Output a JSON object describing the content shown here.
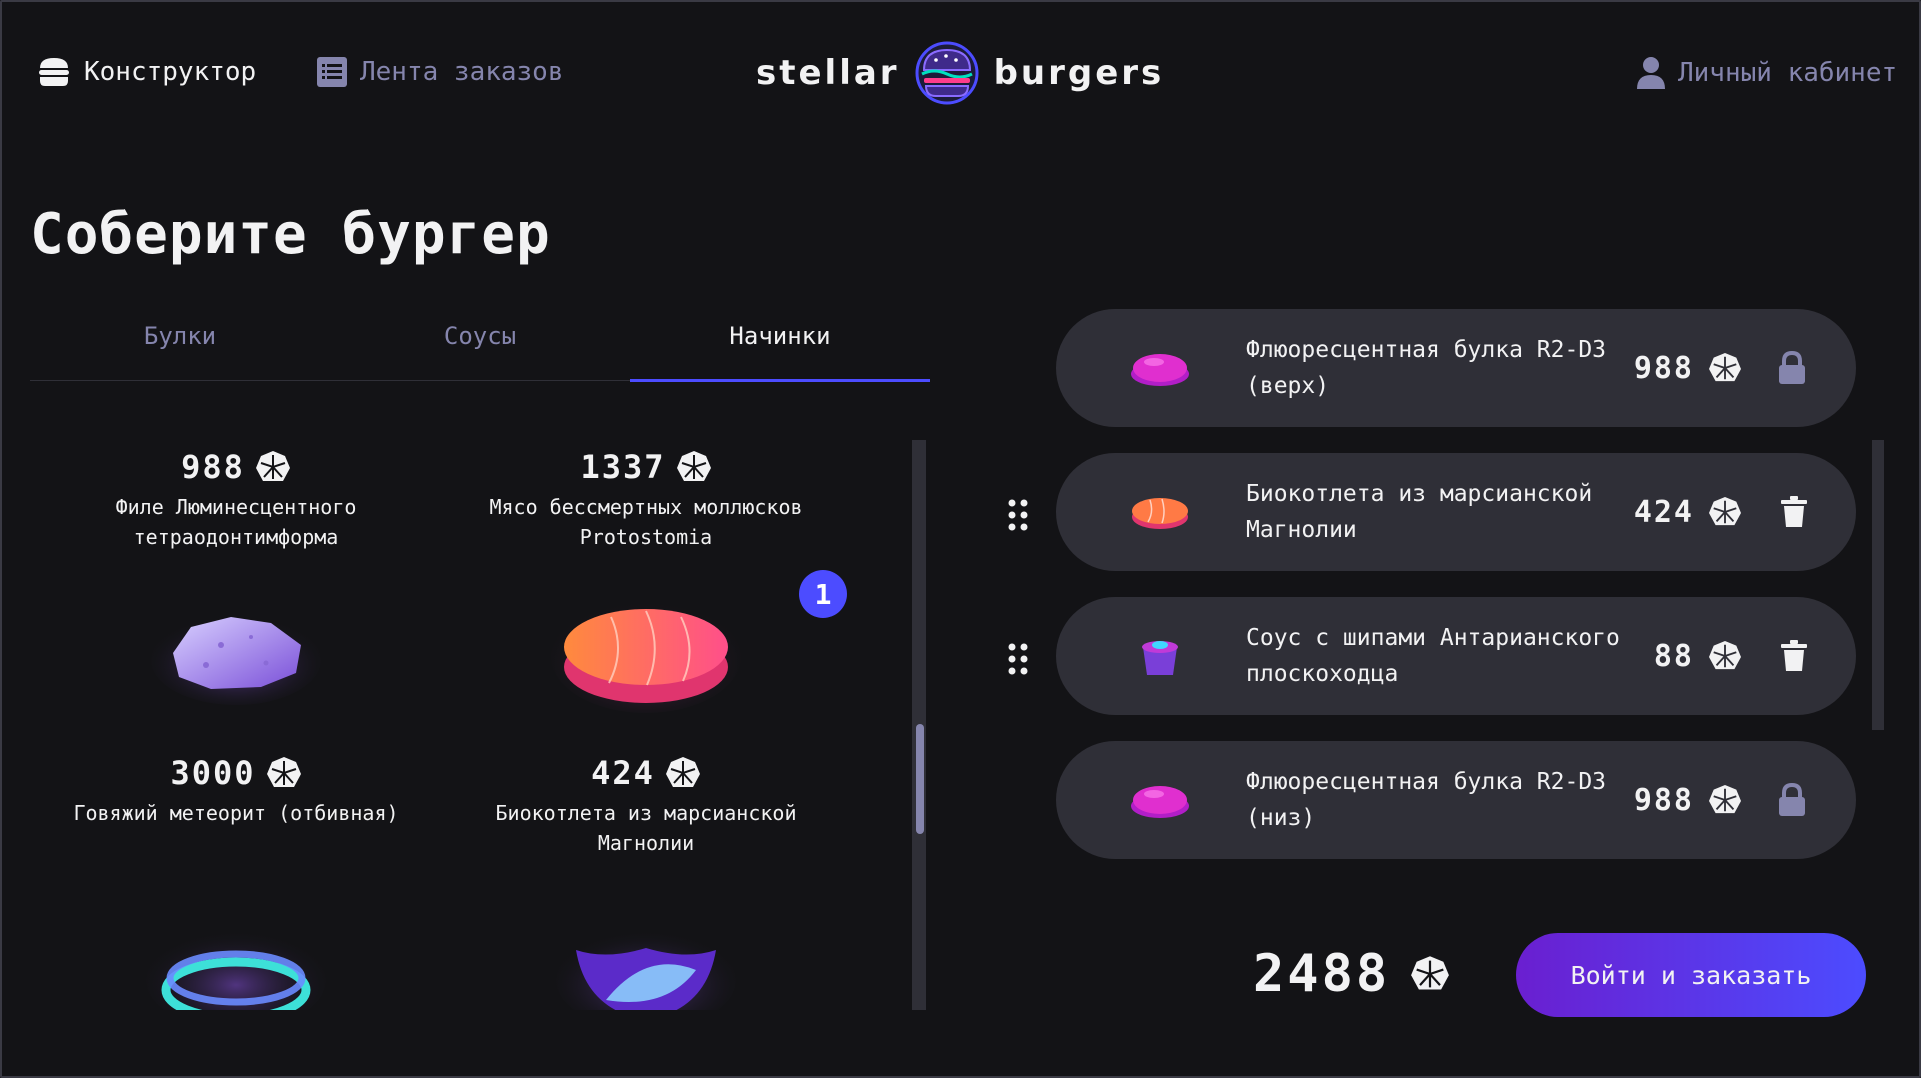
{
  "header": {
    "nav_constructor": "Конструктор",
    "nav_feed": "Лента заказов",
    "logo_left": "stellar",
    "logo_right": "burgers",
    "nav_profile": "Личный кабинет"
  },
  "page_title": "Соберите бургер",
  "tabs": [
    {
      "label": "Булки",
      "active": false
    },
    {
      "label": "Соусы",
      "active": false
    },
    {
      "label": "Начинки",
      "active": true
    }
  ],
  "ingredients": [
    {
      "price": "988",
      "name": "Филе Люминесцентного тетраодонтимформа",
      "icon": "luminescent-fillet-image"
    },
    {
      "price": "1337",
      "name": "Мясо бессмертных моллюсков Protostomia",
      "icon": "mollusk-meat-image"
    },
    {
      "price": "3000",
      "name": "Говяжий метеорит (отбивная)",
      "icon": "meteorite-image"
    },
    {
      "price": "424",
      "name": "Биокотлета из марсианской Магнолии",
      "icon": "bio-patty-image",
      "counter": "1"
    },
    {
      "icon": "rings-image"
    },
    {
      "icon": "leaf-bowl-image"
    }
  ],
  "constructor": {
    "items": [
      {
        "name": "Флюоресцентная булка R2-D3 (верх)",
        "price": "988",
        "action": "lock-icon",
        "locked": true
      },
      {
        "name": "Биокотлета из марсианской Магнолии",
        "price": "424",
        "action": "trash-icon",
        "locked": false
      },
      {
        "name": "Соус с шипами Антарианского плоскоходца",
        "price": "88",
        "action": "trash-icon",
        "locked": false
      },
      {
        "name": "Флюоресцентная булка R2-D3 (низ)",
        "price": "988",
        "action": "lock-icon",
        "locked": true
      }
    ],
    "total": "2488",
    "order_button": "Войти и заказать"
  },
  "colors": {
    "background": "#131316",
    "card": "#2f2f37",
    "accent": "#4c4cff",
    "inactive_text": "#8585ad"
  }
}
